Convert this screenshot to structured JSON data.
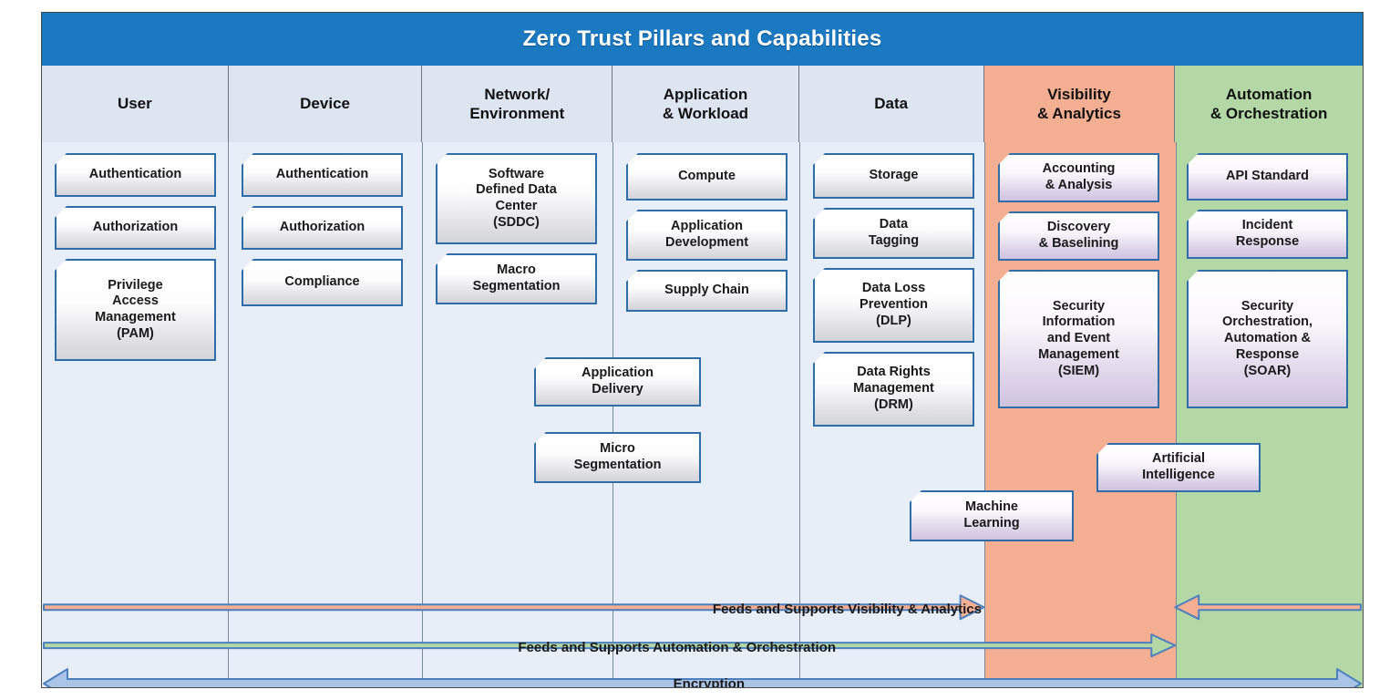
{
  "title": "Zero Trust Pillars and Capabilities",
  "colors": {
    "title_bar": "#1b79c2",
    "header_plain": "#dde5f1",
    "column_plain": "#e8eef8",
    "salmon": "#f4ae92",
    "green": "#b3d8a6",
    "box_border": "#2e6da8",
    "arrow_blue": "#aac4e8"
  },
  "columns": [
    {
      "id": "user",
      "header": "User",
      "tint": "plain",
      "items": [
        {
          "label": "Authentication"
        },
        {
          "label": "Authorization"
        },
        {
          "label": "Privilege\nAccess\nManagement\n(PAM)"
        }
      ]
    },
    {
      "id": "device",
      "header": "Device",
      "tint": "plain",
      "items": [
        {
          "label": "Authentication"
        },
        {
          "label": "Authorization"
        },
        {
          "label": "Compliance"
        }
      ]
    },
    {
      "id": "network-environment",
      "header": "Network/\nEnvironment",
      "tint": "plain",
      "items": [
        {
          "label": "Software\nDefined Data\nCenter\n(SDDC)"
        },
        {
          "label": "Macro\nSegmentation"
        }
      ]
    },
    {
      "id": "application-workload",
      "header": "Application\n& Workload",
      "tint": "plain",
      "items": [
        {
          "label": "Compute"
        },
        {
          "label": "Application\nDevelopment"
        },
        {
          "label": "Supply Chain"
        }
      ]
    },
    {
      "id": "data",
      "header": "Data",
      "tint": "plain",
      "items": [
        {
          "label": "Storage"
        },
        {
          "label": "Data\nTagging"
        },
        {
          "label": "Data Loss\nPrevention\n(DLP)"
        },
        {
          "label": "Data Rights\nManagement\n(DRM)"
        }
      ]
    },
    {
      "id": "visibility-analytics",
      "header": "Visibility\n& Analytics",
      "tint": "salmon",
      "items": [
        {
          "label": "Accounting\n& Analysis"
        },
        {
          "label": "Discovery\n& Baselining"
        },
        {
          "label": "Security\nInformation\nand Event\nManagement\n(SIEM)"
        }
      ]
    },
    {
      "id": "automation-orchestration",
      "header": "Automation\n& Orchestration",
      "tint": "green",
      "items": [
        {
          "label": "API Standard"
        },
        {
          "label": "Incident\nResponse"
        },
        {
          "label": "Security\nOrchestration,\nAutomation &\nResponse\n(SOAR)"
        }
      ]
    }
  ],
  "spanning_items": [
    {
      "id": "application-delivery",
      "label": "Application\nDelivery"
    },
    {
      "id": "micro-segmentation",
      "label": "Micro\nSegmentation"
    },
    {
      "id": "machine-learning",
      "label": "Machine\nLearning"
    },
    {
      "id": "artificial-intelligence",
      "label": "Artificial\nIntelligence"
    }
  ],
  "arrow_bands": [
    {
      "id": "feeds-visibility",
      "label": "Feeds and Supports Visibility & Analytics",
      "color": "#f4ae92"
    },
    {
      "id": "feeds-automation",
      "label": "Feeds and Supports Automation & Orchestration",
      "color": "#b3d8a6"
    },
    {
      "id": "encryption",
      "label": "Encryption",
      "color": "#aac4e8"
    }
  ]
}
